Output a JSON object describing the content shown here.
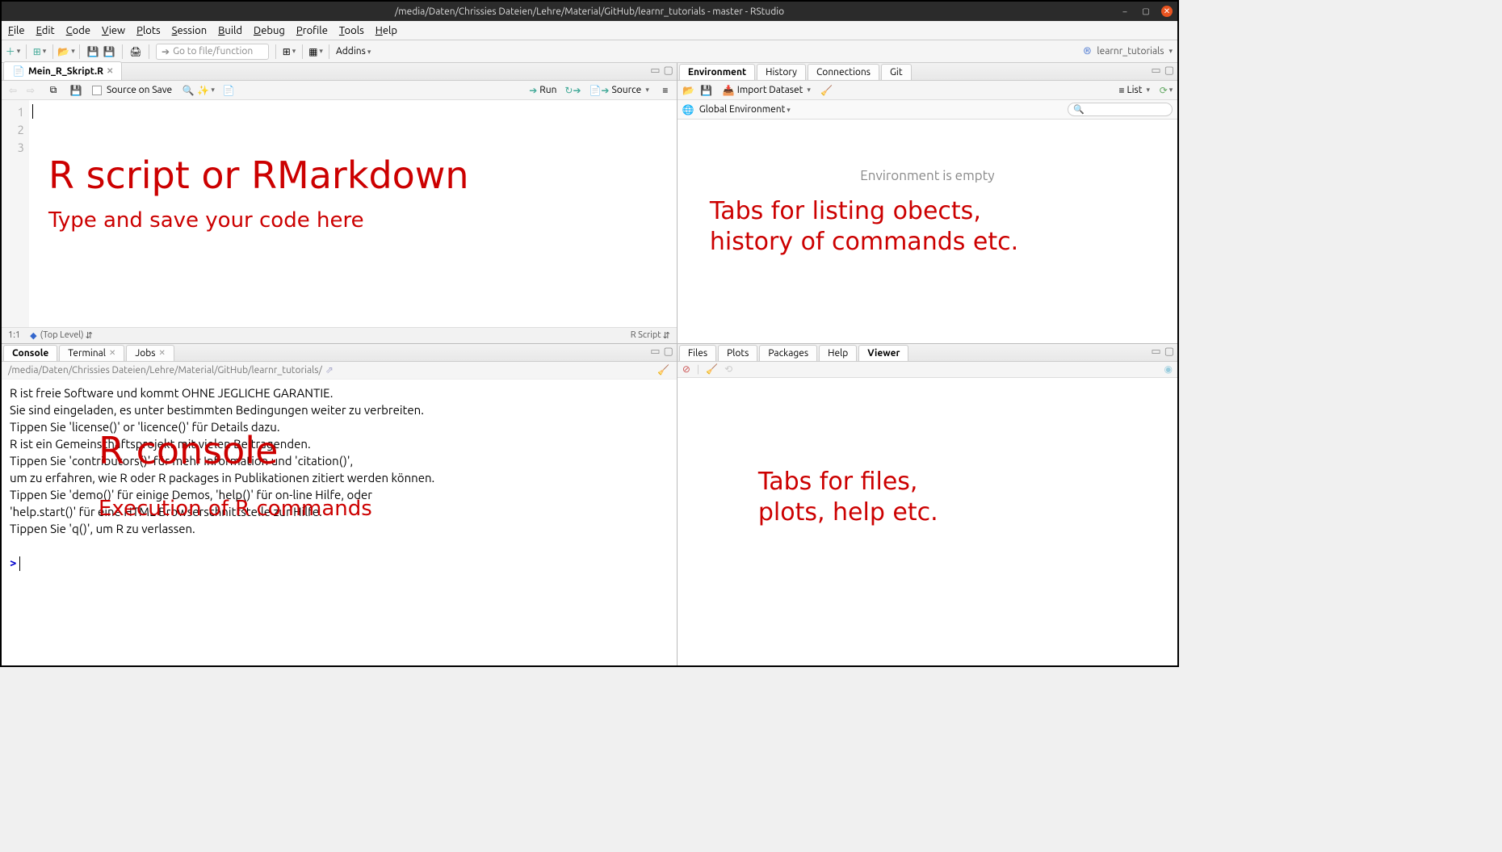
{
  "titlebar": {
    "title": "/media/Daten/Chrissies Dateien/Lehre/Material/GitHub/learnr_tutorials - master - RStudio"
  },
  "menu": [
    "File",
    "Edit",
    "Code",
    "View",
    "Plots",
    "Session",
    "Build",
    "Debug",
    "Profile",
    "Tools",
    "Help"
  ],
  "toolbar": {
    "goto_placeholder": "Go to file/function",
    "addins": "Addins",
    "project": "learnr_tutorials"
  },
  "source": {
    "tab": "Mein_R_Skript.R",
    "source_on_save": "Source on Save",
    "run": "Run",
    "source_btn": "Source",
    "lines": [
      "1",
      "2",
      "3"
    ],
    "status_pos": "1:1",
    "status_scope": "(Top Level)",
    "status_type": "R Script",
    "overlay_title": "R script or RMarkdown",
    "overlay_sub": "Type and save your code here"
  },
  "console": {
    "tabs": [
      "Console",
      "Terminal",
      "Jobs"
    ],
    "path": "/media/Daten/Chrissies Dateien/Lehre/Material/GitHub/learnr_tutorials/",
    "lines": [
      "R ist freie Software und kommt OHNE JEGLICHE GARANTIE.",
      "Sie sind eingeladen, es unter bestimmten Bedingungen weiter zu verbreiten.",
      "Tippen Sie 'license()' or 'licence()' für Details dazu.",
      "",
      "R ist ein Gemeinschaftsprojekt mit vielen Beitragenden.",
      "Tippen Sie 'contributors()' für mehr Information und 'citation()',",
      "um zu erfahren, wie R oder R packages in Publikationen zitiert werden können.",
      "",
      "Tippen Sie 'demo()' für einige Demos, 'help()' für on-line Hilfe, oder",
      "'help.start()' für eine HTML Browserschnittstelle zur Hilfe.",
      "Tippen Sie 'q()', um R zu verlassen."
    ],
    "prompt": ">",
    "overlay_title": "R console",
    "overlay_sub": "Execution of R commands"
  },
  "env": {
    "tabs": [
      "Environment",
      "History",
      "Connections",
      "Git"
    ],
    "import": "Import Dataset",
    "list": "List",
    "scope": "Global Environment",
    "empty": "Environment is empty",
    "overlay": "Tabs for listing obects,\nhistory of commands etc."
  },
  "viewer": {
    "tabs": [
      "Files",
      "Plots",
      "Packages",
      "Help",
      "Viewer"
    ],
    "overlay": "Tabs for files,\nplots, help etc."
  }
}
